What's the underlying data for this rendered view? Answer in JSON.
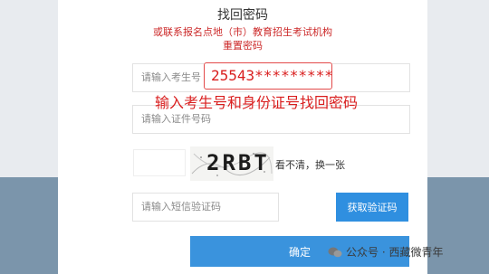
{
  "page": {
    "title": "找回密码",
    "notice_line1": "或联系报名点地（市）教育招生考试机构",
    "notice_line2": "重置密码"
  },
  "form": {
    "exam_number_placeholder": "请输入考生号",
    "id_number_placeholder": "请输入证件号码",
    "captcha_text": "2RBT",
    "refresh_captcha_label": "看不清，换一张",
    "sms_code_placeholder": "请输入短信验证码",
    "get_code_button": "获取验证码",
    "confirm_button": "确定"
  },
  "annotation": {
    "exam_number_example": "25543*********",
    "caption": "输入考生号和身份证号找回密码"
  },
  "watermark": {
    "text": "公众号 · 西藏微青年"
  },
  "colors": {
    "accent": "#2f8fe0",
    "notice_red": "#cc2a2a",
    "annotation_red": "#d91e1e"
  }
}
